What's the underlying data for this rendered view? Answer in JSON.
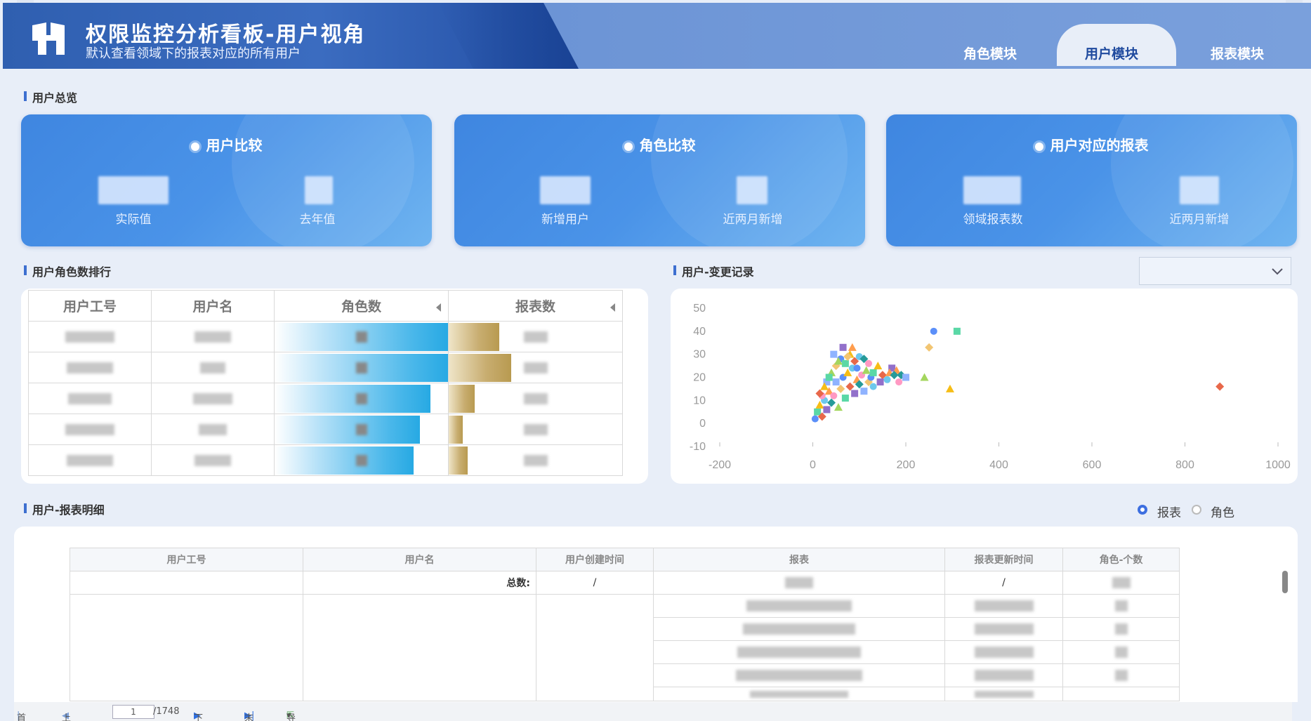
{
  "header": {
    "title": "权限监控分析看板-用户视角",
    "subtitle": "默认查看领域下的报表对应的所有用户",
    "tabs": [
      {
        "label": "角色模块",
        "active": false
      },
      {
        "label": "用户模块",
        "active": true
      },
      {
        "label": "报表模块",
        "active": false
      }
    ]
  },
  "overview": {
    "section_title": "用户总览",
    "cards": [
      {
        "title": "用户比较",
        "labels": [
          "实际值",
          "去年值"
        ]
      },
      {
        "title": "角色比较",
        "labels": [
          "新增用户",
          "近两月新增"
        ]
      },
      {
        "title": "用户对应的报表",
        "labels": [
          "领域报表数",
          "近两月新增"
        ]
      }
    ]
  },
  "ranking": {
    "section_title": "用户角色数排行",
    "columns": [
      "用户工号",
      "用户名",
      "角色数",
      "报表数"
    ],
    "rows": [
      {
        "role_fill": 1.0,
        "report_fill": 0.29
      },
      {
        "role_fill": 1.0,
        "report_fill": 0.36
      },
      {
        "role_fill": 0.9,
        "report_fill": 0.15
      },
      {
        "role_fill": 0.84,
        "report_fill": 0.08
      },
      {
        "role_fill": 0.8,
        "report_fill": 0.11
      }
    ]
  },
  "changes": {
    "section_title": "用户-变更记录",
    "dropdown_value": ""
  },
  "chart_data": {
    "type": "scatter",
    "title": "",
    "xlabel": "",
    "ylabel": "",
    "xlim": [
      -200,
      1000
    ],
    "ylim": [
      -10,
      50
    ],
    "x_ticks": [
      "-200",
      "0",
      "200",
      "400",
      "600",
      "800",
      "1000"
    ],
    "y_ticks": [
      "50",
      "40",
      "30",
      "20",
      "10",
      "0",
      "-10"
    ],
    "series": [
      {
        "values": [
          [
            5,
            2
          ],
          [
            10,
            5
          ],
          [
            15,
            8
          ],
          [
            20,
            3
          ],
          [
            25,
            10
          ],
          [
            30,
            6
          ],
          [
            35,
            14
          ],
          [
            40,
            9
          ],
          [
            45,
            12
          ],
          [
            50,
            18
          ],
          [
            55,
            7
          ],
          [
            60,
            15
          ],
          [
            65,
            20
          ],
          [
            70,
            11
          ],
          [
            75,
            22
          ],
          [
            80,
            16
          ],
          [
            85,
            24
          ],
          [
            90,
            13
          ],
          [
            95,
            19
          ],
          [
            100,
            17
          ],
          [
            105,
            21
          ],
          [
            110,
            14
          ],
          [
            115,
            23
          ],
          [
            120,
            18
          ],
          [
            125,
            20
          ],
          [
            130,
            22
          ],
          [
            140,
            25
          ],
          [
            150,
            21
          ],
          [
            160,
            19
          ],
          [
            170,
            24
          ],
          [
            180,
            23
          ],
          [
            190,
            21
          ],
          [
            20,
            12
          ],
          [
            30,
            18
          ],
          [
            40,
            22
          ],
          [
            50,
            25
          ],
          [
            60,
            28
          ],
          [
            70,
            26
          ],
          [
            80,
            30
          ],
          [
            90,
            27
          ],
          [
            100,
            29
          ],
          [
            65,
            33
          ],
          [
            85,
            33
          ],
          [
            110,
            28
          ],
          [
            120,
            26
          ],
          [
            45,
            30
          ],
          [
            55,
            27
          ],
          [
            75,
            29
          ],
          [
            95,
            24
          ],
          [
            35,
            20
          ],
          [
            25,
            16
          ],
          [
            15,
            13
          ],
          [
            130,
            16
          ],
          [
            145,
            18
          ],
          [
            165,
            22
          ],
          [
            175,
            21
          ],
          [
            185,
            18
          ],
          [
            200,
            20
          ],
          [
            240,
            20
          ],
          [
            250,
            33
          ],
          [
            260,
            40
          ],
          [
            310,
            40
          ],
          [
            295,
            15
          ],
          [
            875,
            16
          ]
        ]
      }
    ]
  },
  "detail": {
    "section_title": "用户-报表明细",
    "radio_options": [
      {
        "label": "报表",
        "checked": true
      },
      {
        "label": "角色",
        "checked": false
      }
    ],
    "columns": [
      "用户工号",
      "用户名",
      "用户创建时间",
      "报表",
      "报表更新时间",
      "角色-个数"
    ],
    "total_label": "总数:",
    "total_create": "/",
    "total_update": "/"
  },
  "pager": {
    "first": "首页",
    "prev": "上一页",
    "page": "1",
    "total": "/1748",
    "next": "下一页",
    "last": "末页",
    "export": "导出"
  }
}
